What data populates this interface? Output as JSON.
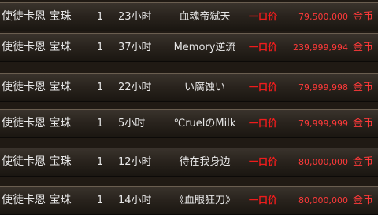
{
  "listings": [
    {
      "name": "使徒卡恩 宝珠",
      "qty": "1",
      "time": "23小时",
      "seller": "血魂帝弑天",
      "price_label": "一口价",
      "price": "79,500,000",
      "currency": "金币"
    },
    {
      "name": "使徒卡恩 宝珠",
      "qty": "1",
      "time": "37小时",
      "seller": "Memory逆流",
      "price_label": "一口价",
      "price": "239,999,994",
      "currency": "金币"
    },
    {
      "name": "使徒卡恩 宝珠",
      "qty": "1",
      "time": "22小时",
      "seller": "い腐蚀い",
      "price_label": "一口价",
      "price": "79,999,998",
      "currency": "金币"
    },
    {
      "name": "使徒卡恩 宝珠",
      "qty": "1",
      "time": "5小时",
      "seller": "℃ruelのMilk",
      "price_label": "一口价",
      "price": "79,999,999",
      "currency": "金币"
    },
    {
      "name": "使徒卡恩 宝珠",
      "qty": "1",
      "time": "12小时",
      "seller": "待在我身边",
      "price_label": "一口价",
      "price": "80,000,000",
      "currency": "金币"
    },
    {
      "name": "使徒卡恩 宝珠",
      "qty": "1",
      "time": "14小时",
      "seller": "《血眼狂刀》",
      "price_label": "一口价",
      "price": "80,000,000",
      "currency": "金币"
    }
  ],
  "colors": {
    "text": "#e7e7e7",
    "price_red": "#ff3a3a",
    "label_red": "#ee1c1c",
    "row_top": "#3a332c",
    "row_bottom": "#1a1611"
  }
}
